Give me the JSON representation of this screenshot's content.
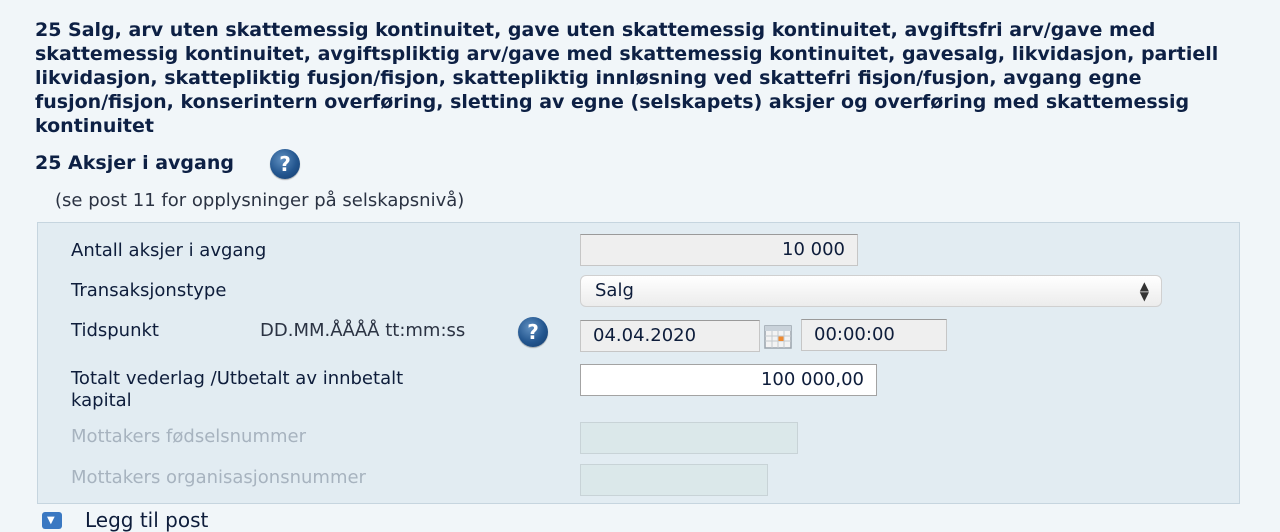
{
  "section": {
    "title": "25 Salg, arv uten skattemessig kontinuitet, gave uten skattemessig kontinuitet, avgiftsfri arv/gave med skattemessig kontinuitet, avgiftspliktig arv/gave med skattemessig kontinuitet, gavesalg, likvidasjon, partiell likvidasjon, skattepliktig fusjon/fisjon, skattepliktig innløsning ved skattefri fisjon/fusjon, avgang egne fusjon/fisjon, konserintern overføring, sletting av egne (selskapets) aksjer og overføring med skattemessig kontinuitet",
    "subtitle": "25 Aksjer i avgang",
    "help_glyph": "?",
    "note": "(se post 11 for opplysninger på selskapsnivå)"
  },
  "form": {
    "shares_label": "Antall aksjer i avgang",
    "shares_value": "10 000",
    "transaction_label": "Transaksjonstype",
    "transaction_value": "Salg",
    "time_label": "Tidspunkt",
    "time_format": "DD.MM.ÅÅÅÅ tt:mm:ss",
    "date_value": "04.04.2020",
    "time_value": "00:00:00",
    "consideration_label_line1": "Totalt vederlag /Utbetalt av innbetalt",
    "consideration_label_line2": "kapital",
    "consideration_value": "100 000,00",
    "recipient_ssn_label": "Mottakers fødselsnummer",
    "recipient_org_label": "Mottakers organisasjonsnummer"
  },
  "footer": {
    "add_post_label": "Legg til post"
  },
  "colors": {
    "background": "#f1f6f9",
    "panel": "#e2ecf2",
    "title": "#0d2044",
    "help_icon": "#23568f",
    "disabled_label": "#a7b3bf"
  },
  "icons": {
    "help": "help-icon",
    "calendar": "calendar-icon",
    "add": "add-post-icon",
    "select_arrows": "select-arrows-icon"
  }
}
